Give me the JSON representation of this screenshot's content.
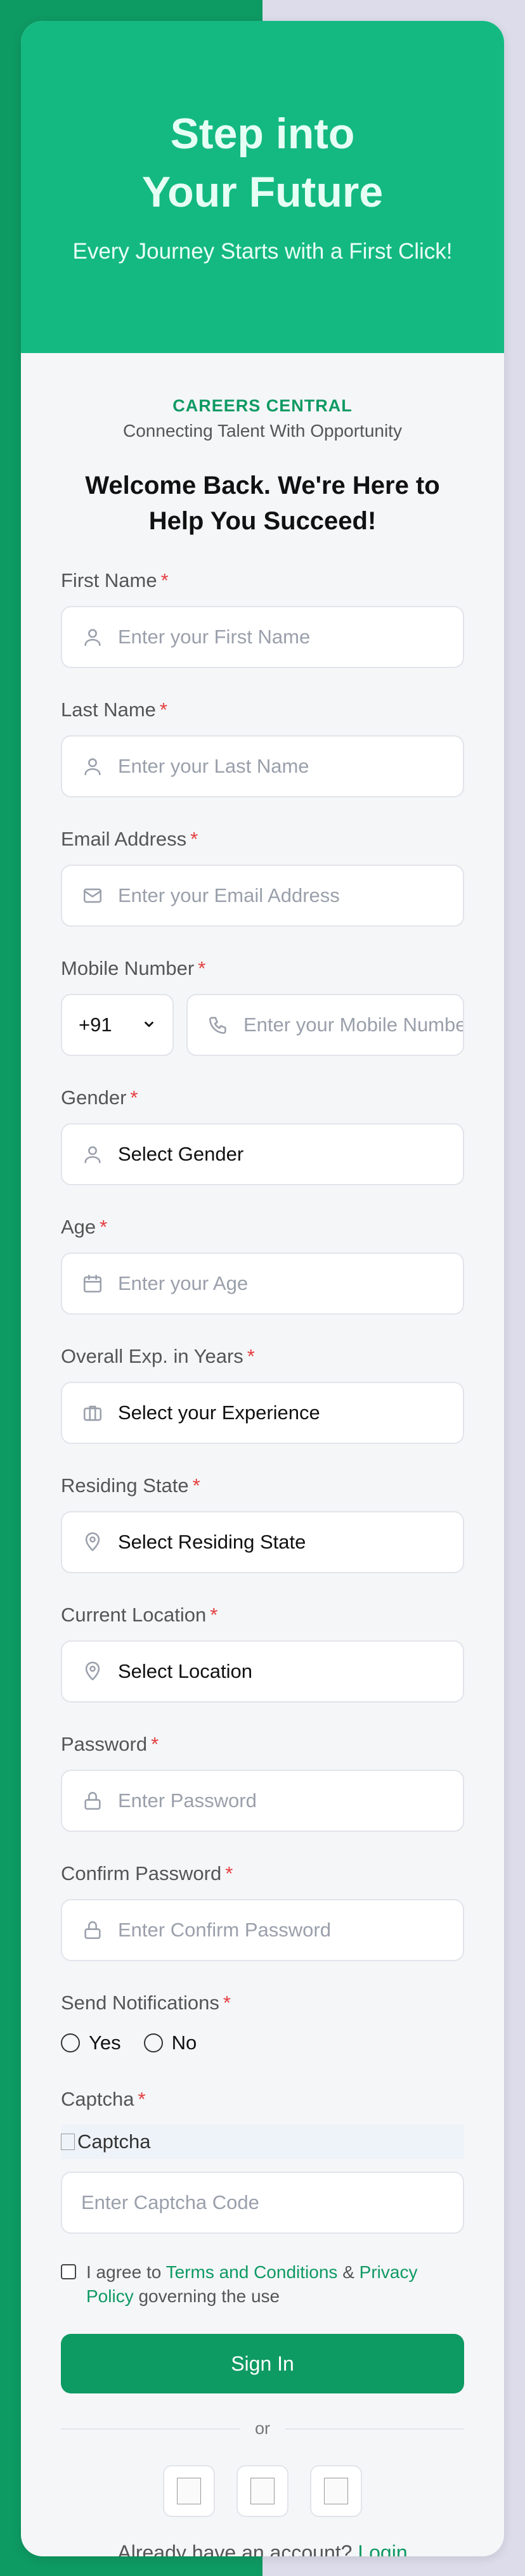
{
  "hero": {
    "title_line1": "Step into",
    "title_line2": "Your Future",
    "subtitle": "Every Journey Starts with a First Click!"
  },
  "brand": {
    "name": "CAREERS CENTRAL",
    "tagline": "Connecting Talent With Opportunity"
  },
  "welcome": "Welcome Back. We're Here to Help You Succeed!",
  "fields": {
    "first_name": {
      "label": "First Name",
      "placeholder": "Enter your First Name"
    },
    "last_name": {
      "label": "Last Name",
      "placeholder": "Enter your Last Name"
    },
    "email": {
      "label": "Email Address",
      "placeholder": "Enter your Email Address"
    },
    "mobile": {
      "label": "Mobile Number",
      "country_code": "+91",
      "placeholder": "Enter your Mobile Number"
    },
    "gender": {
      "label": "Gender",
      "value": "Select Gender"
    },
    "age": {
      "label": "Age",
      "placeholder": "Enter your Age"
    },
    "experience": {
      "label": "Overall Exp. in Years",
      "value": "Select your Experience"
    },
    "state": {
      "label": "Residing State",
      "value": "Select Residing State"
    },
    "location": {
      "label": "Current Location",
      "value": "Select Location"
    },
    "password": {
      "label": "Password",
      "placeholder": "Enter Password"
    },
    "confirm_password": {
      "label": "Confirm Password",
      "placeholder": "Enter Confirm Password"
    },
    "notifications": {
      "label": "Send Notifications",
      "options": [
        "Yes",
        "No"
      ]
    },
    "captcha": {
      "label": "Captcha",
      "image_alt": "Captcha",
      "placeholder": "Enter Captcha Code"
    }
  },
  "required_mark": "*",
  "terms": {
    "prefix": "I agree to",
    "terms_link": "Terms and Conditions",
    "amp": "&",
    "privacy_link": "Privacy Policy",
    "suffix": "governing the use"
  },
  "signin_label": "Sign In",
  "divider_text": "or",
  "login": {
    "prompt": "Already have an account?",
    "link": "Login"
  },
  "colors": {
    "primary": "#0e9a63",
    "hero": "#14b981",
    "required": "#e53e3e"
  }
}
